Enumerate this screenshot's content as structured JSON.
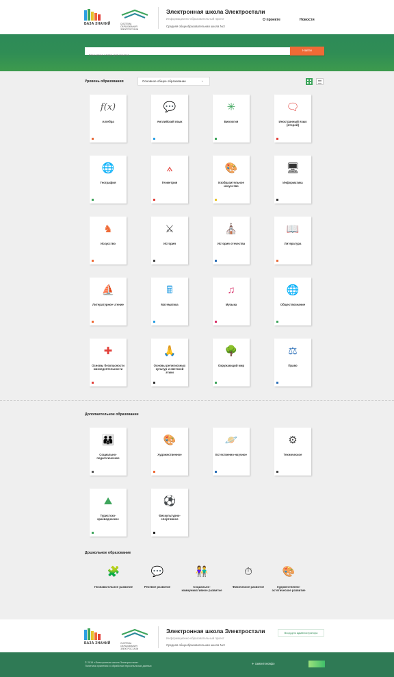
{
  "header": {
    "logo1_text": "БАЗА ЗНАНИЙ",
    "logo2_lines": [
      "СИСТЕМА",
      "ОБРАЗОВАНИЯ",
      "ЭЛЕКТРОСТАЛИ"
    ],
    "title": "Электронная школа Электростали",
    "subtitle": "Информационно-образовательный проект",
    "school": "Средняя общеобразовательная школа №3",
    "nav": [
      "О проекте",
      "Новости"
    ]
  },
  "search": {
    "placeholder": "Ключевое слово для поиска",
    "button": "Найти"
  },
  "level": {
    "label": "Уровень образования",
    "selected": "Основное общее образование"
  },
  "subjects": [
    {
      "label": "Алгебра",
      "icon": "fx-icon",
      "glyph": "f(x)",
      "color": "#555555",
      "mark": "#e86a3a"
    },
    {
      "label": "Английский язык",
      "icon": "speech-bubble-abc-icon",
      "glyph": "💬",
      "color": "#2b9fe3",
      "mark": "#2b9fe3"
    },
    {
      "label": "Биология",
      "icon": "virus-cell-icon",
      "glyph": "✳",
      "color": "#3ea55c",
      "mark": "#3ea55c"
    },
    {
      "label": "Иностранный язык (второй)",
      "icon": "foreign-speech-icon",
      "glyph": "🗨",
      "color": "#e2403a",
      "mark": "#e2403a"
    },
    {
      "label": "География",
      "icon": "globe-icon",
      "glyph": "🌐",
      "color": "#3ea55c",
      "mark": "#3ea55c"
    },
    {
      "label": "Геометрия",
      "icon": "compass-icon",
      "glyph": "⟑",
      "color": "#e2403a",
      "mark": "#e2403a"
    },
    {
      "label": "Изобразительное искусство",
      "icon": "palette-icon",
      "glyph": "🎨",
      "color": "#e6c32c",
      "mark": "#e6c32c"
    },
    {
      "label": "Информатика",
      "icon": "computer-icon",
      "glyph": "🖥",
      "color": "#333333",
      "mark": "#333333"
    },
    {
      "label": "Искусство",
      "icon": "bust-icon",
      "glyph": "♞",
      "color": "#ef6a36",
      "mark": "#ef6a36"
    },
    {
      "label": "История",
      "icon": "shield-swords-icon",
      "glyph": "⚔",
      "color": "#444444",
      "mark": "#444444"
    },
    {
      "label": "История отечества",
      "icon": "church-icon",
      "glyph": "⛪",
      "color": "#2b6fb8",
      "mark": "#2b6fb8"
    },
    {
      "label": "Литература",
      "icon": "open-book-icon",
      "glyph": "📖",
      "color": "#e86a3a",
      "mark": "#e86a3a"
    },
    {
      "label": "Литературное чтение",
      "icon": "book-ship-icon",
      "glyph": "⛵",
      "color": "#ef6a36",
      "mark": "#ef6a36"
    },
    {
      "label": "Математика",
      "icon": "calculator-icon",
      "glyph": "🖩",
      "color": "#2b9fe3",
      "mark": "#2b9fe3"
    },
    {
      "label": "Музыка",
      "icon": "music-notes-icon",
      "glyph": "♫",
      "color": "#d8326a",
      "mark": "#d8326a"
    },
    {
      "label": "Обществознание",
      "icon": "world-grid-icon",
      "glyph": "🌐",
      "color": "#3ea55c",
      "mark": "#3ea55c"
    },
    {
      "label": "Основы безопасности жизнедеятельности",
      "icon": "safety-icon",
      "glyph": "✚",
      "color": "#e2403a",
      "mark": "#e2403a"
    },
    {
      "label": "Основы религиозных культур и светской этики",
      "icon": "praying-hands-icon",
      "glyph": "🙏",
      "color": "#333333",
      "mark": "#333333"
    },
    {
      "label": "Окружающий мир",
      "icon": "tree-sun-icon",
      "glyph": "🌳",
      "color": "#3ea55c",
      "mark": "#3ea55c"
    },
    {
      "label": "Право",
      "icon": "scales-icon",
      "glyph": "⚖",
      "color": "#2b6fb8",
      "mark": "#2b6fb8"
    }
  ],
  "additional": {
    "title": "Дополнительное образование",
    "items": [
      {
        "label": "Социально-педагогическое",
        "icon": "group-people-icon",
        "glyph": "👪",
        "color": "#555555",
        "mark": "#555555"
      },
      {
        "label": "Художественное",
        "icon": "paint-palette-icon",
        "glyph": "🎨",
        "color": "#ef6a36",
        "mark": "#ef6a36"
      },
      {
        "label": "Естественно-научное",
        "icon": "planet-icon",
        "glyph": "🪐",
        "color": "#7b4fd6",
        "mark": "#2b6fb8"
      },
      {
        "label": "Техническое",
        "icon": "chip-icon",
        "glyph": "⚙",
        "color": "#444444",
        "mark": "#444444"
      },
      {
        "label": "Туристско-краеведческое",
        "icon": "mountain-sun-icon",
        "glyph": "⛰",
        "color": "#3ea55c",
        "mark": "#3ea55c"
      },
      {
        "label": "Физкультурно-спортивное",
        "icon": "soccer-ball-icon",
        "glyph": "⚽",
        "color": "#222222",
        "mark": "#222222"
      }
    ]
  },
  "preschool": {
    "title": "Дошкольное образование",
    "items": [
      {
        "label": "Познавательное развитие",
        "icon": "puzzle-icon",
        "glyph": "🧩",
        "color": "#3ea55c"
      },
      {
        "label": "Речевое развитие",
        "icon": "chat-check-icon",
        "glyph": "💬",
        "color": "#7b4fd6"
      },
      {
        "label": "Социально-коммуникативное развитие",
        "icon": "kids-faces-icon",
        "glyph": "👫",
        "color": "#2b9fe3"
      },
      {
        "label": "Физическое развитие",
        "icon": "stopwatch-icon",
        "glyph": "⏱",
        "color": "#333333"
      },
      {
        "label": "Художественно-эстетическое развитие",
        "icon": "art-palette-icon",
        "glyph": "🎨",
        "color": "#ef6a36"
      }
    ]
  },
  "footer": {
    "admin": "Вход для администратора",
    "copyright": "© 2019 «Электронная школа Электростали»",
    "policy": "Политика хранения и обработки персональных данных",
    "partner": "самоитоновфо"
  }
}
